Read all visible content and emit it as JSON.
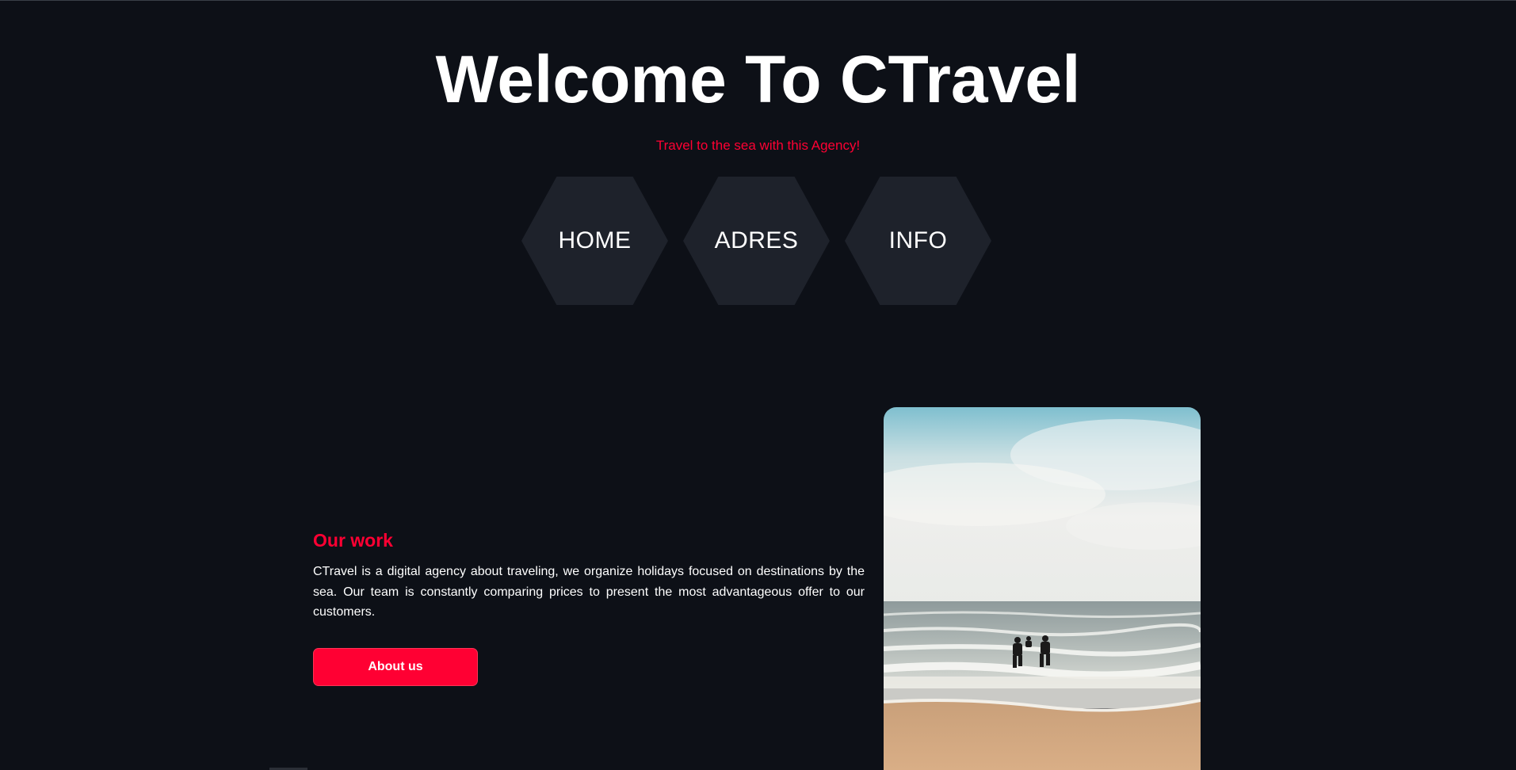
{
  "header": {
    "title": "Welcome To CTravel",
    "subtitle": "Travel to the sea with this Agency!"
  },
  "nav": {
    "items": [
      {
        "label": "HOME"
      },
      {
        "label": "ADRES"
      },
      {
        "label": "INFO"
      }
    ]
  },
  "work": {
    "heading": "Our work",
    "body": "CTravel is a digital agency about traveling, we organize holidays focused on destinations by the sea. Our team is constantly comparing prices to present the most advantageous offer to our customers.",
    "button_label": "About us"
  },
  "photo": {
    "subject": "people running into the sea on a sandy beach"
  },
  "colors": {
    "background": "#0d1017",
    "accent": "#ff0033",
    "hex_fill": "#1e222b",
    "text": "#ffffff"
  }
}
